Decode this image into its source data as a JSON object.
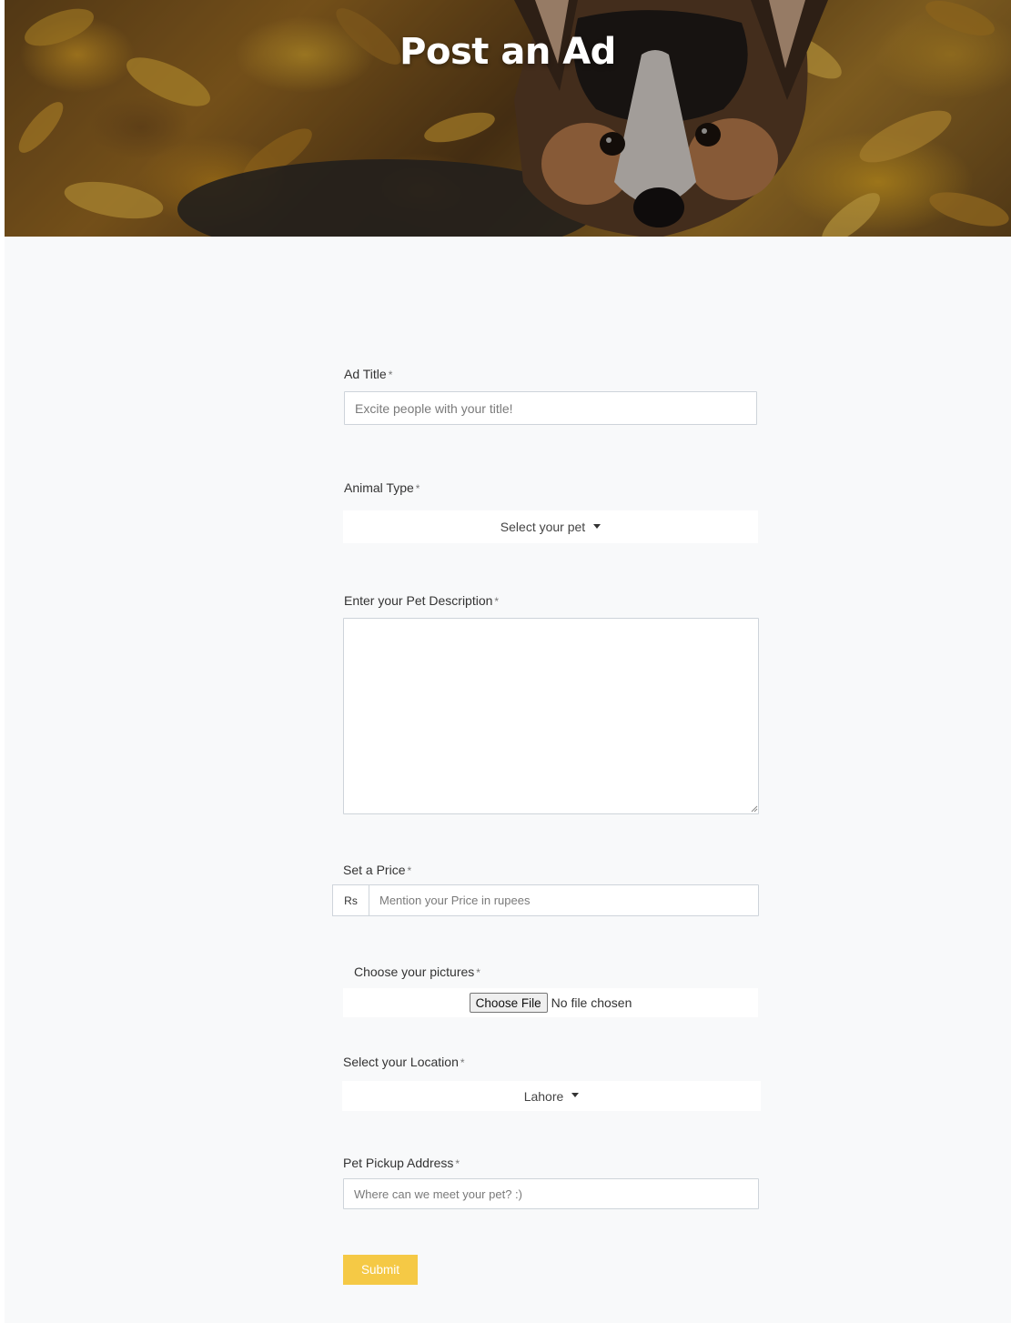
{
  "header": {
    "title": "Post an Ad"
  },
  "form": {
    "required_marker": "*",
    "ad_title": {
      "label": "Ad Title",
      "placeholder": "Excite people with your title!",
      "value": ""
    },
    "animal_type": {
      "label": "Animal Type",
      "selected": "Select your pet"
    },
    "description": {
      "label": "Enter your Pet Description",
      "value": ""
    },
    "price": {
      "label": "Set a Price",
      "prefix": "Rs",
      "placeholder": "Mention your Price in rupees",
      "value": ""
    },
    "pictures": {
      "label": "Choose your pictures",
      "button_label": "Choose File",
      "status": "No file chosen"
    },
    "location": {
      "label": "Select your Location",
      "selected": "Lahore"
    },
    "pickup_address": {
      "label": "Pet Pickup Address",
      "placeholder": "Where can we meet your pet? :)",
      "value": ""
    },
    "submit_label": "Submit"
  },
  "colors": {
    "page_background": "#f8f9fa",
    "submit_button": "#f5c945",
    "input_border": "#ced4da"
  }
}
